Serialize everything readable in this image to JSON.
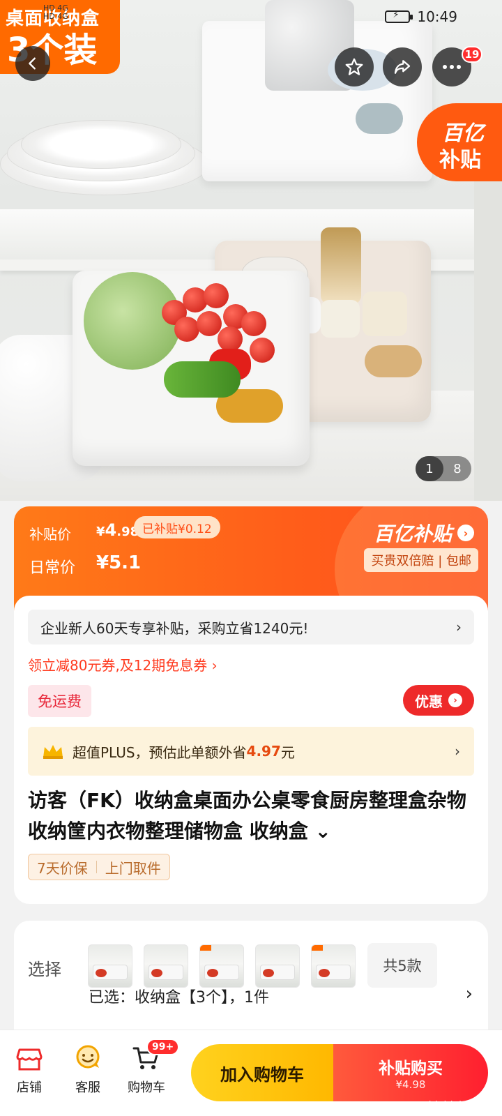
{
  "statusbar": {
    "network": [
      "HD",
      "4G",
      "HD",
      "4G"
    ],
    "time": "10:49"
  },
  "hero": {
    "promo_line1": "桌面收纳盒",
    "promo_line2": "3个装",
    "more_badge": "19",
    "yi_badge_line1": "百亿",
    "yi_badge_line2": "补贴",
    "image_current": "1",
    "image_total": "8"
  },
  "price": {
    "subsidy_label": "补贴价",
    "subsidy_currency": "¥",
    "subsidy_int": "4",
    "subsidy_dec": ".98",
    "saved_text": "已补贴¥0.12",
    "daily_label": "日常价",
    "daily_price": "¥5.1",
    "program_name": "百亿补贴",
    "guarantee_text": "买贵双倍赔 | 包邮"
  },
  "info": {
    "enterprise_text": "企业新人60天专享补贴，采购立省1240元!",
    "coupon_text": "领立减80元券,及12期免息券 ›",
    "free_shipping": "免运费",
    "discount_button": "优惠",
    "plus_prefix": "超值PLUS，预估此单额外省",
    "plus_amount": "4.97",
    "plus_suffix": "元",
    "title": "访客（FK）收纳盒桌面办公桌零食厨房整理盒杂物收纳筐内衣物整理储物盒 收纳盒 ⌄",
    "tags": [
      "7天价保",
      "上门取件"
    ]
  },
  "sku": {
    "label": "选择",
    "variant_count": "共5款",
    "selected_text": "已选：收纳盒【3个】，1件"
  },
  "bottom": {
    "store": "店铺",
    "service": "客服",
    "cart": "购物车",
    "cart_badge": "99+",
    "add_to_cart": "加入购物车",
    "buy_line1": "补贴购买",
    "buy_line2": "¥4.98",
    "watermark": "zhizhizhi.com"
  },
  "colors": {
    "accent_orange": "#ff6a00",
    "subsidy_red": "#ee2a2a",
    "cart_yellow": "#ffc20e"
  }
}
